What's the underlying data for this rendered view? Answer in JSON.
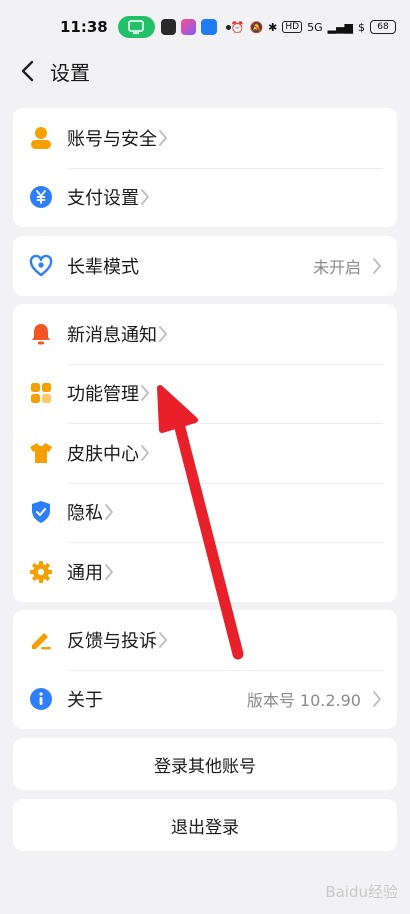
{
  "status": {
    "time": "11:38",
    "network": "5G",
    "battery": "68"
  },
  "header": {
    "title": "设置"
  },
  "groups": {
    "account": [
      {
        "label": "账号与安全"
      },
      {
        "label": "支付设置"
      }
    ],
    "elder": [
      {
        "label": "长辈模式",
        "value": "未开启"
      }
    ],
    "features": [
      {
        "label": "新消息通知"
      },
      {
        "label": "功能管理"
      },
      {
        "label": "皮肤中心"
      },
      {
        "label": "隐私"
      },
      {
        "label": "通用"
      }
    ],
    "support": [
      {
        "label": "反馈与投诉"
      },
      {
        "label": "关于",
        "value": "版本号 10.2.90"
      }
    ]
  },
  "actions": {
    "switch_account": "登录其他账号",
    "logout": "退出登录"
  },
  "watermark": "Baidu经验",
  "colors": {
    "accent_orange": "#f5a000",
    "blue": "#2d7ff9",
    "red": "#f25424",
    "arrow": "#e8202a"
  }
}
